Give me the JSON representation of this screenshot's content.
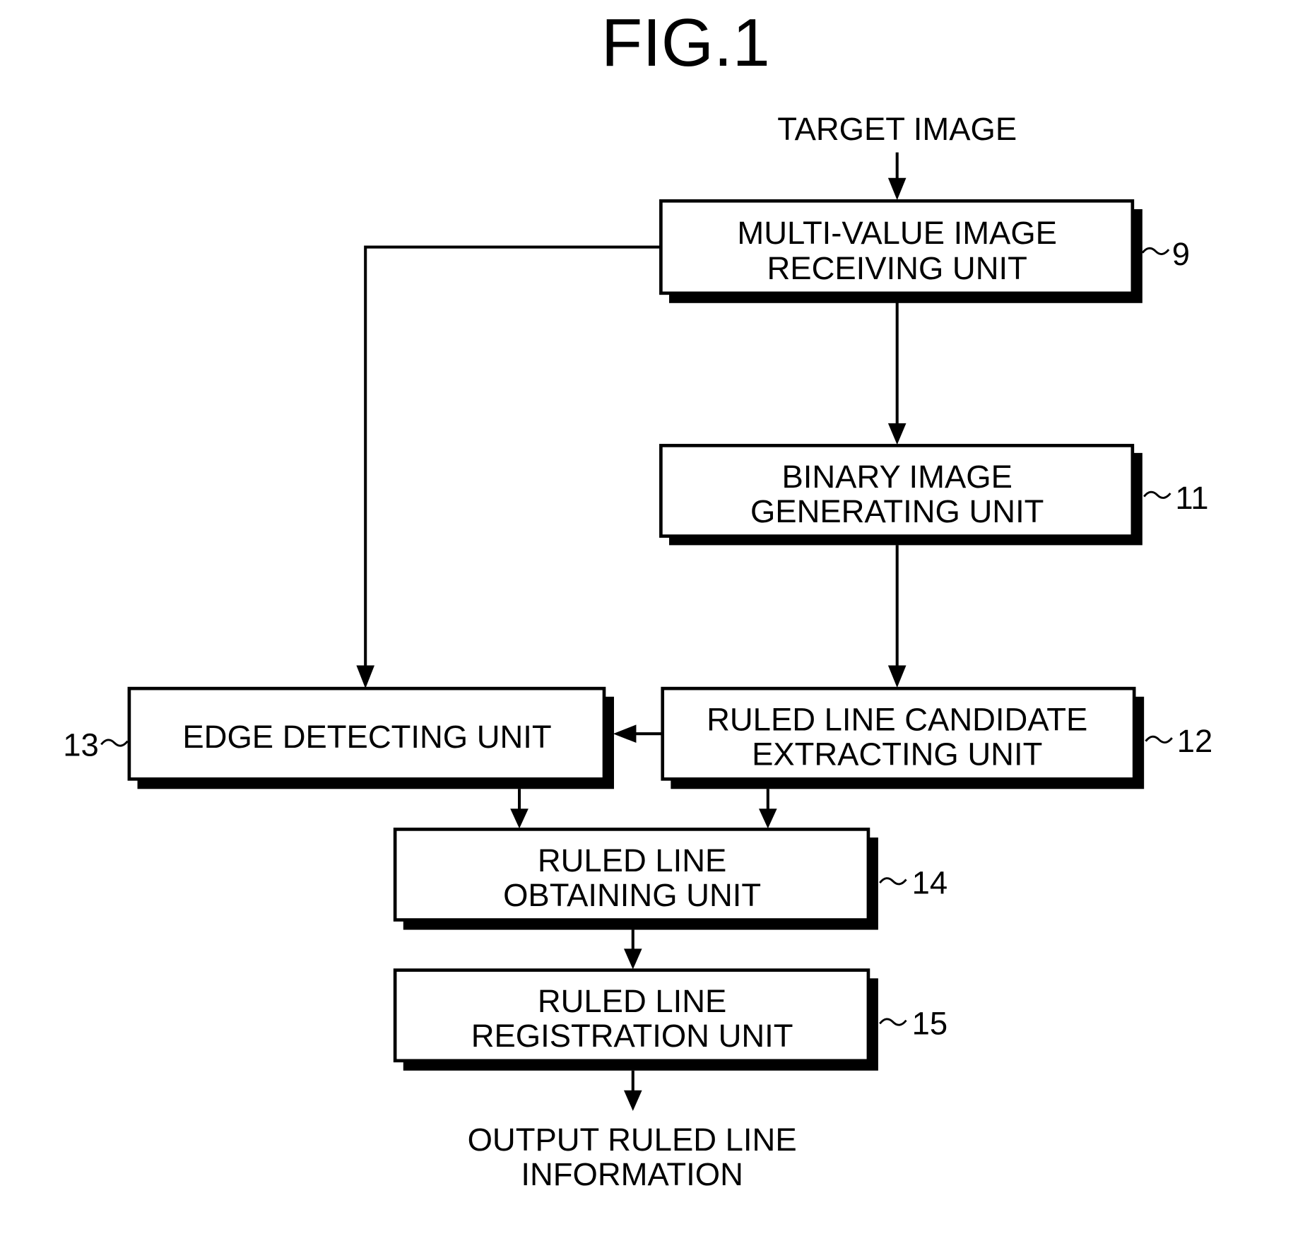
{
  "figure": {
    "title": "FIG.1",
    "input_label": "TARGET IMAGE",
    "output_label": [
      "OUTPUT RULED LINE",
      "INFORMATION"
    ],
    "colors": {
      "ink": "#000000",
      "paper": "#ffffff"
    },
    "units": [
      {
        "id": "multi-value-image-receiving-unit",
        "ref": "9",
        "lines": [
          "MULTI-VALUE IMAGE",
          "RECEIVING UNIT"
        ]
      },
      {
        "id": "binary-image-generating-unit",
        "ref": "11",
        "lines": [
          "BINARY IMAGE",
          "GENERATING UNIT"
        ]
      },
      {
        "id": "ruled-line-candidate-extracting-unit",
        "ref": "12",
        "lines": [
          "RULED LINE CANDIDATE",
          "EXTRACTING UNIT"
        ]
      },
      {
        "id": "edge-detecting-unit",
        "ref": "13",
        "lines": [
          "EDGE DETECTING UNIT"
        ]
      },
      {
        "id": "ruled-line-obtaining-unit",
        "ref": "14",
        "lines": [
          "RULED LINE",
          "OBTAINING UNIT"
        ]
      },
      {
        "id": "ruled-line-registration-unit",
        "ref": "15",
        "lines": [
          "RULED LINE",
          "REGISTRATION UNIT"
        ]
      }
    ],
    "connections": [
      {
        "from": "input",
        "to": "multi-value-image-receiving-unit"
      },
      {
        "from": "multi-value-image-receiving-unit",
        "to": "binary-image-generating-unit"
      },
      {
        "from": "multi-value-image-receiving-unit",
        "to": "edge-detecting-unit"
      },
      {
        "from": "binary-image-generating-unit",
        "to": "ruled-line-candidate-extracting-unit"
      },
      {
        "from": "ruled-line-candidate-extracting-unit",
        "to": "edge-detecting-unit"
      },
      {
        "from": "edge-detecting-unit",
        "to": "ruled-line-obtaining-unit"
      },
      {
        "from": "ruled-line-candidate-extracting-unit",
        "to": "ruled-line-obtaining-unit"
      },
      {
        "from": "ruled-line-obtaining-unit",
        "to": "ruled-line-registration-unit"
      },
      {
        "from": "ruled-line-registration-unit",
        "to": "output"
      }
    ]
  }
}
